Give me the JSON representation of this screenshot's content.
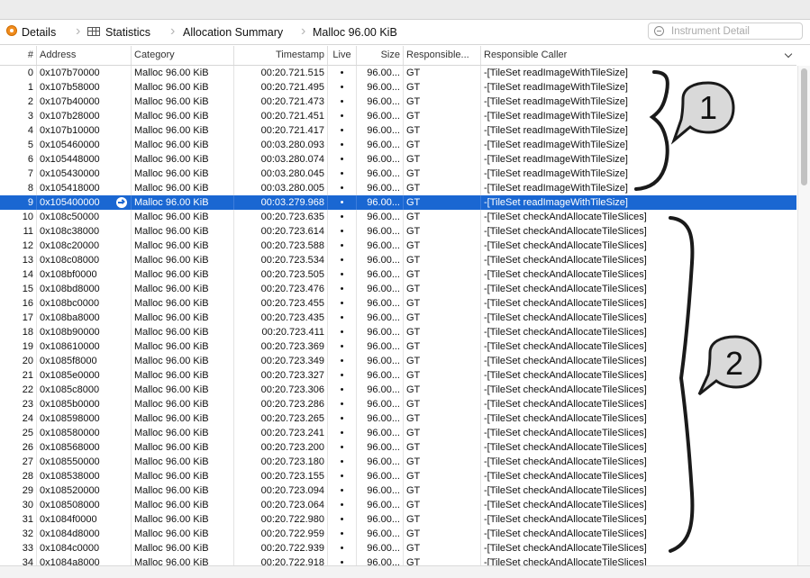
{
  "jump_bar": {
    "items": [
      "Details",
      "Statistics",
      "Allocation Summary",
      "Malloc 96.00 KiB"
    ]
  },
  "search": {
    "placeholder": "Instrument Detail"
  },
  "columns": [
    "#",
    "Address",
    "Category",
    "Timestamp",
    "Live",
    "Size",
    "Responsible...",
    "Responsible Caller"
  ],
  "selected_row_index": 9,
  "rows": [
    [
      "0",
      "0x107b70000",
      "Malloc 96.00 KiB",
      "00:20.721.515",
      "•",
      "96.00...",
      "GT",
      "-[TileSet readImageWithTileSize]"
    ],
    [
      "1",
      "0x107b58000",
      "Malloc 96.00 KiB",
      "00:20.721.495",
      "•",
      "96.00...",
      "GT",
      "-[TileSet readImageWithTileSize]"
    ],
    [
      "2",
      "0x107b40000",
      "Malloc 96.00 KiB",
      "00:20.721.473",
      "•",
      "96.00...",
      "GT",
      "-[TileSet readImageWithTileSize]"
    ],
    [
      "3",
      "0x107b28000",
      "Malloc 96.00 KiB",
      "00:20.721.451",
      "•",
      "96.00...",
      "GT",
      "-[TileSet readImageWithTileSize]"
    ],
    [
      "4",
      "0x107b10000",
      "Malloc 96.00 KiB",
      "00:20.721.417",
      "•",
      "96.00...",
      "GT",
      "-[TileSet readImageWithTileSize]"
    ],
    [
      "5",
      "0x105460000",
      "Malloc 96.00 KiB",
      "00:03.280.093",
      "•",
      "96.00...",
      "GT",
      "-[TileSet readImageWithTileSize]"
    ],
    [
      "6",
      "0x105448000",
      "Malloc 96.00 KiB",
      "00:03.280.074",
      "•",
      "96.00...",
      "GT",
      "-[TileSet readImageWithTileSize]"
    ],
    [
      "7",
      "0x105430000",
      "Malloc 96.00 KiB",
      "00:03.280.045",
      "•",
      "96.00...",
      "GT",
      "-[TileSet readImageWithTileSize]"
    ],
    [
      "8",
      "0x105418000",
      "Malloc 96.00 KiB",
      "00:03.280.005",
      "•",
      "96.00...",
      "GT",
      "-[TileSet readImageWithTileSize]"
    ],
    [
      "9",
      "0x105400000",
      "Malloc 96.00 KiB",
      "00:03.279.968",
      "•",
      "96.00...",
      "GT",
      "-[TileSet readImageWithTileSize]"
    ],
    [
      "10",
      "0x108c50000",
      "Malloc 96.00 KiB",
      "00:20.723.635",
      "•",
      "96.00...",
      "GT",
      "-[TileSet checkAndAllocateTileSlices]"
    ],
    [
      "11",
      "0x108c38000",
      "Malloc 96.00 KiB",
      "00:20.723.614",
      "•",
      "96.00...",
      "GT",
      "-[TileSet checkAndAllocateTileSlices]"
    ],
    [
      "12",
      "0x108c20000",
      "Malloc 96.00 KiB",
      "00:20.723.588",
      "•",
      "96.00...",
      "GT",
      "-[TileSet checkAndAllocateTileSlices]"
    ],
    [
      "13",
      "0x108c08000",
      "Malloc 96.00 KiB",
      "00:20.723.534",
      "•",
      "96.00...",
      "GT",
      "-[TileSet checkAndAllocateTileSlices]"
    ],
    [
      "14",
      "0x108bf0000",
      "Malloc 96.00 KiB",
      "00:20.723.505",
      "•",
      "96.00...",
      "GT",
      "-[TileSet checkAndAllocateTileSlices]"
    ],
    [
      "15",
      "0x108bd8000",
      "Malloc 96.00 KiB",
      "00:20.723.476",
      "•",
      "96.00...",
      "GT",
      "-[TileSet checkAndAllocateTileSlices]"
    ],
    [
      "16",
      "0x108bc0000",
      "Malloc 96.00 KiB",
      "00:20.723.455",
      "•",
      "96.00...",
      "GT",
      "-[TileSet checkAndAllocateTileSlices]"
    ],
    [
      "17",
      "0x108ba8000",
      "Malloc 96.00 KiB",
      "00:20.723.435",
      "•",
      "96.00...",
      "GT",
      "-[TileSet checkAndAllocateTileSlices]"
    ],
    [
      "18",
      "0x108b90000",
      "Malloc 96.00 KiB",
      "00:20.723.411",
      "•",
      "96.00...",
      "GT",
      "-[TileSet checkAndAllocateTileSlices]"
    ],
    [
      "19",
      "0x108610000",
      "Malloc 96.00 KiB",
      "00:20.723.369",
      "•",
      "96.00...",
      "GT",
      "-[TileSet checkAndAllocateTileSlices]"
    ],
    [
      "20",
      "0x1085f8000",
      "Malloc 96.00 KiB",
      "00:20.723.349",
      "•",
      "96.00...",
      "GT",
      "-[TileSet checkAndAllocateTileSlices]"
    ],
    [
      "21",
      "0x1085e0000",
      "Malloc 96.00 KiB",
      "00:20.723.327",
      "•",
      "96.00...",
      "GT",
      "-[TileSet checkAndAllocateTileSlices]"
    ],
    [
      "22",
      "0x1085c8000",
      "Malloc 96.00 KiB",
      "00:20.723.306",
      "•",
      "96.00...",
      "GT",
      "-[TileSet checkAndAllocateTileSlices]"
    ],
    [
      "23",
      "0x1085b0000",
      "Malloc 96.00 KiB",
      "00:20.723.286",
      "•",
      "96.00...",
      "GT",
      "-[TileSet checkAndAllocateTileSlices]"
    ],
    [
      "24",
      "0x108598000",
      "Malloc 96.00 KiB",
      "00:20.723.265",
      "•",
      "96.00...",
      "GT",
      "-[TileSet checkAndAllocateTileSlices]"
    ],
    [
      "25",
      "0x108580000",
      "Malloc 96.00 KiB",
      "00:20.723.241",
      "•",
      "96.00...",
      "GT",
      "-[TileSet checkAndAllocateTileSlices]"
    ],
    [
      "26",
      "0x108568000",
      "Malloc 96.00 KiB",
      "00:20.723.200",
      "•",
      "96.00...",
      "GT",
      "-[TileSet checkAndAllocateTileSlices]"
    ],
    [
      "27",
      "0x108550000",
      "Malloc 96.00 KiB",
      "00:20.723.180",
      "•",
      "96.00...",
      "GT",
      "-[TileSet checkAndAllocateTileSlices]"
    ],
    [
      "28",
      "0x108538000",
      "Malloc 96.00 KiB",
      "00:20.723.155",
      "•",
      "96.00...",
      "GT",
      "-[TileSet checkAndAllocateTileSlices]"
    ],
    [
      "29",
      "0x108520000",
      "Malloc 96.00 KiB",
      "00:20.723.094",
      "•",
      "96.00...",
      "GT",
      "-[TileSet checkAndAllocateTileSlices]"
    ],
    [
      "30",
      "0x108508000",
      "Malloc 96.00 KiB",
      "00:20.723.064",
      "•",
      "96.00...",
      "GT",
      "-[TileSet checkAndAllocateTileSlices]"
    ],
    [
      "31",
      "0x1084f0000",
      "Malloc 96.00 KiB",
      "00:20.722.980",
      "•",
      "96.00...",
      "GT",
      "-[TileSet checkAndAllocateTileSlices]"
    ],
    [
      "32",
      "0x1084d8000",
      "Malloc 96.00 KiB",
      "00:20.722.959",
      "•",
      "96.00...",
      "GT",
      "-[TileSet checkAndAllocateTileSlices]"
    ],
    [
      "33",
      "0x1084c0000",
      "Malloc 96.00 KiB",
      "00:20.722.939",
      "•",
      "96.00...",
      "GT",
      "-[TileSet checkAndAllocateTileSlices]"
    ],
    [
      "34",
      "0x1084a8000",
      "Malloc 96.00 KiB",
      "00:20.722.918",
      "•",
      "96.00...",
      "GT",
      "-[TileSet checkAndAllocateTileSlices]"
    ]
  ],
  "annotations": {
    "callout_1": "1",
    "callout_2": "2"
  },
  "colors": {
    "selection": "#1a67d2",
    "callout_fill": "#d9d9d9"
  }
}
